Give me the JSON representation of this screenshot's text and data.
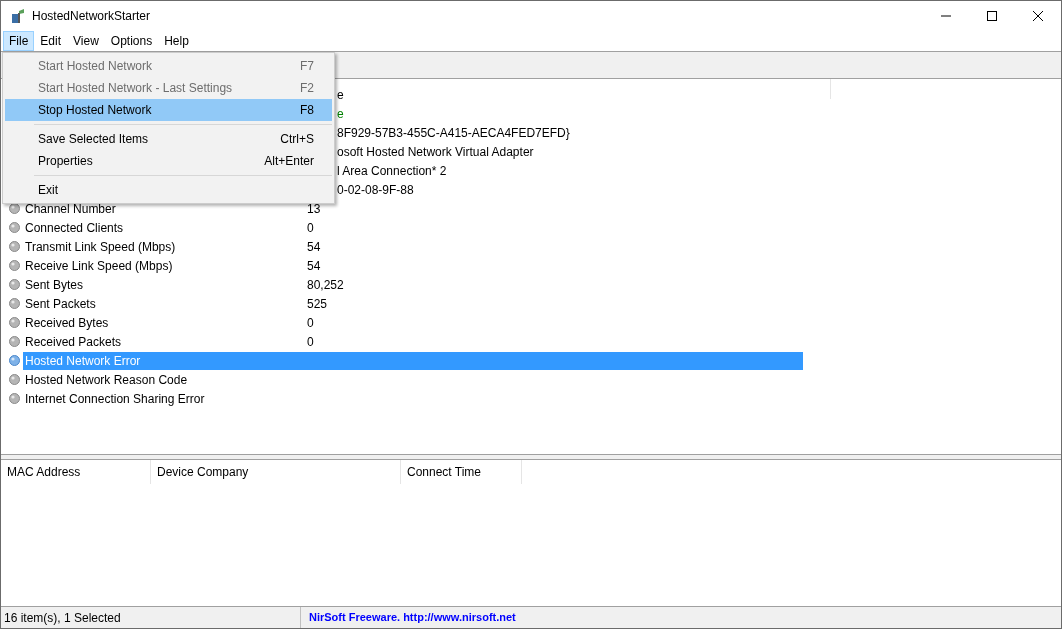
{
  "window": {
    "title": "HostedNetworkStarter"
  },
  "menu_bar": [
    {
      "label": "File",
      "selected": true
    },
    {
      "label": "Edit",
      "selected": false
    },
    {
      "label": "View",
      "selected": false
    },
    {
      "label": "Options",
      "selected": false
    },
    {
      "label": "Help",
      "selected": false
    }
  ],
  "file_menu": [
    {
      "kind": "item",
      "label": "Start Hosted Network",
      "shortcut": "F7",
      "disabled": true,
      "selected": false
    },
    {
      "kind": "item",
      "label": "Start Hosted Network -  Last Settings",
      "shortcut": "F2",
      "disabled": true,
      "selected": false
    },
    {
      "kind": "item",
      "label": "Stop Hosted Network",
      "shortcut": "F8",
      "disabled": false,
      "selected": true
    },
    {
      "kind": "separator"
    },
    {
      "kind": "item",
      "label": "Save Selected Items",
      "shortcut": "Ctrl+S",
      "disabled": false,
      "selected": false
    },
    {
      "kind": "item",
      "label": "Properties",
      "shortcut": "Alt+Enter",
      "disabled": false,
      "selected": false
    },
    {
      "kind": "separator"
    },
    {
      "kind": "item",
      "label": "Exit",
      "disabled": false,
      "selected": false
    }
  ],
  "properties": [
    {
      "value": "e",
      "selected": false
    },
    {
      "value": "e",
      "color": "#008000",
      "selected": false
    },
    {
      "value": "8F929-57B3-455C-A415-AECA4FED7EFD}",
      "selected": false
    },
    {
      "value": "osoft Hosted Network Virtual Adapter",
      "selected": false
    },
    {
      "value": "l Area Connection* 2",
      "selected": false
    },
    {
      "value": "0-02-08-9F-88",
      "selected": false
    },
    {
      "name": "Channel Number",
      "value": "13",
      "selected": false
    },
    {
      "name": "Connected Clients",
      "value": "0",
      "selected": false
    },
    {
      "name": "Transmit Link Speed (Mbps)",
      "value": "54",
      "selected": false
    },
    {
      "name": "Receive Link Speed (Mbps)",
      "value": "54",
      "selected": false
    },
    {
      "name": "Sent Bytes",
      "value": "80,252",
      "selected": false
    },
    {
      "name": "Sent Packets",
      "value": "525",
      "selected": false
    },
    {
      "name": "Received Bytes",
      "value": "0",
      "selected": false
    },
    {
      "name": "Received Packets",
      "value": "0",
      "selected": false
    },
    {
      "name": "Hosted Network Error",
      "selected": true
    },
    {
      "name": "Hosted Network Reason Code",
      "selected": false
    },
    {
      "name": "Internet Connection Sharing Error",
      "selected": false
    }
  ],
  "clients_table": {
    "columns": [
      "MAC Address",
      "Device Company",
      "Connect Time"
    ]
  },
  "status_bar": {
    "items": "16 item(s), 1 Selected",
    "credit": "NirSoft Freeware.  http://www.nirsoft.net"
  }
}
